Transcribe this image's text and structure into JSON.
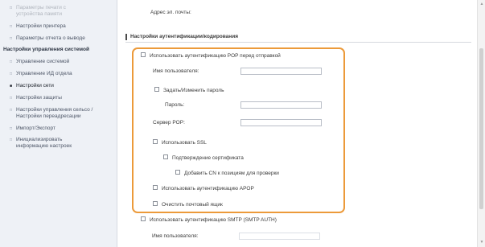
{
  "sidebar": {
    "items": [
      {
        "label": "Параметры печати с",
        "label2": "устройства памяти"
      },
      {
        "label": "Настройки принтера"
      },
      {
        "label": "Параметры отчета о выводе"
      },
      {
        "label": "Настройки управления системой"
      },
      {
        "label": "Управление системой"
      },
      {
        "label": "Управление ИД отдела"
      },
      {
        "label": "Настройки сети"
      },
      {
        "label": "Настройки защиты"
      },
      {
        "label": "Настройки управления сельсо /",
        "label2": "Настройки переадресации"
      },
      {
        "label": "Импорт/Экспорт"
      },
      {
        "label": "Инициализировать",
        "label2": "информацию настроек"
      }
    ]
  },
  "main": {
    "top_faded_label": "Адрес эл. почты:",
    "section_title": "Настройки аутентификации/кодирования",
    "panel": {
      "pop_before_send": "Использовать аутентификацию POP перед отправкой",
      "username": "Имя пользователя:",
      "set_password": "Задать/Изменить пароль",
      "password": "Пароль:",
      "pop_server": "Сервер POP:",
      "use_ssl": "Использовать SSL",
      "confirm_cert": "Подтверждение сертификата",
      "add_cn": "Добавить CN к позициям для проверки",
      "use_apop": "Использовать аутентификацию APOP",
      "clear_mailbox": "Очистить почтовый ящик"
    },
    "smtp_auth": "Использовать аутентификацию SMTP (SMTP AUTH)",
    "bottom_faded_username": "Имя пользователя:"
  },
  "colors": {
    "highlight_border": "#ec9a3a",
    "sidebar_bg": "#eef1f6"
  }
}
